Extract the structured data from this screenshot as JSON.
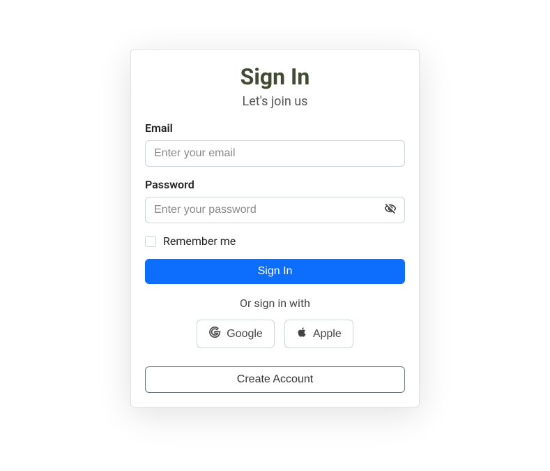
{
  "header": {
    "title": "Sign In",
    "subtitle": "Let's join us"
  },
  "form": {
    "email_label": "Email",
    "email_placeholder": "Enter your email",
    "password_label": "Password",
    "password_placeholder": "Enter your password",
    "remember_label": "Remember me",
    "submit_label": "Sign In"
  },
  "social": {
    "divider_text": "Or sign in with",
    "google_label": "Google",
    "apple_label": "Apple"
  },
  "footer": {
    "create_account_label": "Create Account"
  }
}
